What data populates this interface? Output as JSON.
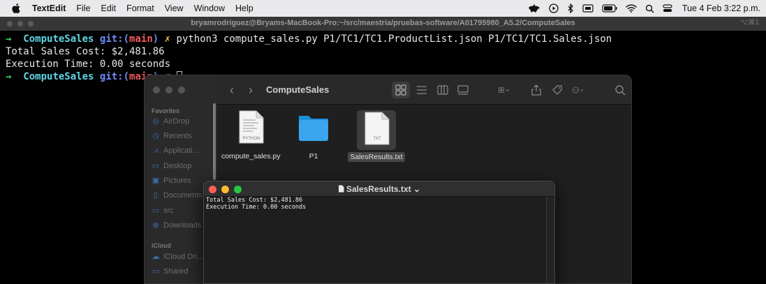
{
  "menubar": {
    "app_name": "TextEdit",
    "items": [
      "File",
      "Edit",
      "Format",
      "View",
      "Window",
      "Help"
    ],
    "clock": "Tue 4 Feb  3:22 p.m."
  },
  "terminal": {
    "title": "bryamrodriguez@Bryams-MacBook-Pro:~/src/maestria/pruebas-software/A01795980_A5.2/ComputeSales",
    "shortcut": "⌥⌘1",
    "line1": {
      "arrow": "→",
      "dir": "ComputeSales",
      "git_prefix": "git:(",
      "branch": "main",
      "git_suffix": ")",
      "dirty": "✗",
      "command": "python3 compute_sales.py P1/TC1/TC1.ProductList.json P1/TC1/TC1.Sales.json"
    },
    "line2": "Total Sales Cost: $2,481.86",
    "line3": "Execution Time: 0.00 seconds",
    "line4": {
      "arrow": "→",
      "dir": "ComputeSales",
      "git_prefix": "git:(",
      "branch": "main",
      "git_suffix": ")",
      "dirty": "✗"
    }
  },
  "finder": {
    "folder_title": "ComputeSales",
    "sidebar": {
      "favorites_heading": "Favorites",
      "favorites": [
        "AirDrop",
        "Recents",
        "Applicati...",
        "Desktop",
        "Pictures",
        "Documents",
        "src",
        "Downloads"
      ],
      "icloud_heading": "iCloud",
      "icloud": [
        "iCloud Dri...",
        "Shared"
      ]
    },
    "files": [
      {
        "name": "compute_sales.py",
        "badge": "PYTHON",
        "kind": "python"
      },
      {
        "name": "P1",
        "badge": "",
        "kind": "folder"
      },
      {
        "name": "SalesResults.txt",
        "badge": "TXT",
        "kind": "txt"
      }
    ]
  },
  "textedit": {
    "title": "SalesResults.txt",
    "line1": "Total Sales Cost: $2,481.86",
    "line2": "Execution Time: 0.00 seconds"
  }
}
